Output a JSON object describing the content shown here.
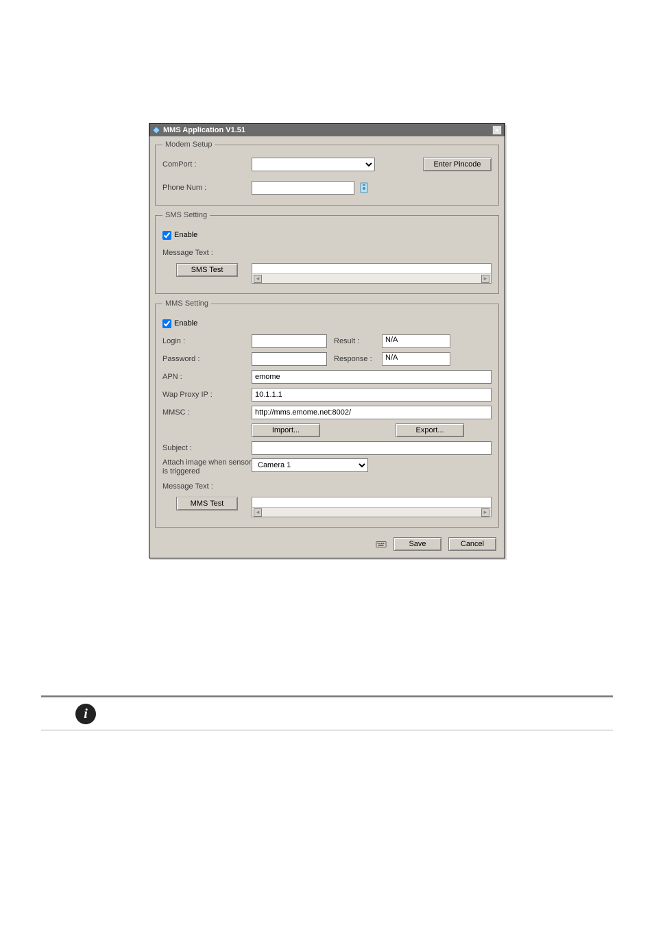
{
  "dialog": {
    "title": "MMS Application V1.51",
    "close_label": "×"
  },
  "modem": {
    "legend": "Modem Setup",
    "comport_label": "ComPort :",
    "comport_value": "",
    "enter_pincode_label": "Enter Pincode",
    "phone_label": "Phone Num :",
    "phone_value": ""
  },
  "sms": {
    "legend": "SMS Setting",
    "enable_label": "Enable",
    "enable_checked": true,
    "message_text_label": "Message Text :",
    "sms_test_label": "SMS Test"
  },
  "mms": {
    "legend": "MMS Setting",
    "enable_label": "Enable",
    "enable_checked": true,
    "login_label": "Login :",
    "login_value": "",
    "result_label": "Result :",
    "result_value": "N/A",
    "password_label": "Password :",
    "password_value": "",
    "response_label": "Response :",
    "response_value": "N/A",
    "apn_label": "APN :",
    "apn_value": "emome",
    "wap_label": "Wap Proxy IP :",
    "wap_value": "10.1.1.1",
    "mmsc_label": "MMSC :",
    "mmsc_value": "http://mms.emome.net:8002/",
    "import_label": "Import...",
    "export_label": "Export...",
    "subject_label": "Subject :",
    "subject_value": "",
    "attach_label": "Attach image when sensor is triggered",
    "attach_value": "Camera 1",
    "message_text_label": "Message Text :",
    "mms_test_label": "MMS Test"
  },
  "footer": {
    "save_label": "Save",
    "cancel_label": "Cancel"
  }
}
